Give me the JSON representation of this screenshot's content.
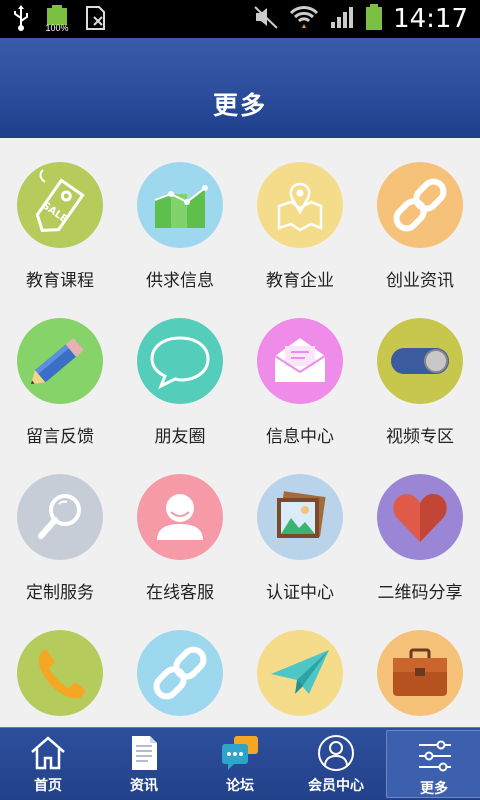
{
  "status_bar": {
    "time": "14:17",
    "battery_label": "100%"
  },
  "header": {
    "title": "更多"
  },
  "grid": {
    "items": [
      {
        "label": "教育课程",
        "icon": "sale-tag-icon",
        "color": "#b5cc5c"
      },
      {
        "label": "供求信息",
        "icon": "bar-chart-icon",
        "color": "#9ed8ef"
      },
      {
        "label": "教育企业",
        "icon": "map-pin-icon",
        "color": "#f4dc8a"
      },
      {
        "label": "创业资讯",
        "icon": "link-icon",
        "color": "#f6c27a"
      },
      {
        "label": "留言反馈",
        "icon": "pencil-icon",
        "color": "#86d36a"
      },
      {
        "label": "朋友圈",
        "icon": "chat-bubble-icon",
        "color": "#55cdbb"
      },
      {
        "label": "信息中心",
        "icon": "envelope-icon",
        "color": "#ef8be8"
      },
      {
        "label": "视频专区",
        "icon": "toggle-icon",
        "color": "#c7c74e"
      },
      {
        "label": "定制服务",
        "icon": "magnifier-icon",
        "color": "#c7cdd6"
      },
      {
        "label": "在线客服",
        "icon": "person-icon",
        "color": "#f59aa6"
      },
      {
        "label": "认证中心",
        "icon": "picture-icon",
        "color": "#b8d3ea"
      },
      {
        "label": "二维码分享",
        "icon": "heart-icon",
        "color": "#9b86d6"
      },
      {
        "label": "",
        "icon": "phone-icon",
        "color": "#b5cc5c"
      },
      {
        "label": "",
        "icon": "link-icon",
        "color": "#9ed8ef"
      },
      {
        "label": "",
        "icon": "paper-plane-icon",
        "color": "#f4dc8a"
      },
      {
        "label": "",
        "icon": "briefcase-icon",
        "color": "#f6c27a"
      }
    ]
  },
  "bottom_nav": {
    "items": [
      {
        "label": "首页",
        "icon": "home-icon"
      },
      {
        "label": "资讯",
        "icon": "document-icon"
      },
      {
        "label": "论坛",
        "icon": "forum-icon"
      },
      {
        "label": "会员中心",
        "icon": "member-icon"
      },
      {
        "label": "更多",
        "icon": "settings-sliders-icon",
        "active": true
      }
    ]
  }
}
